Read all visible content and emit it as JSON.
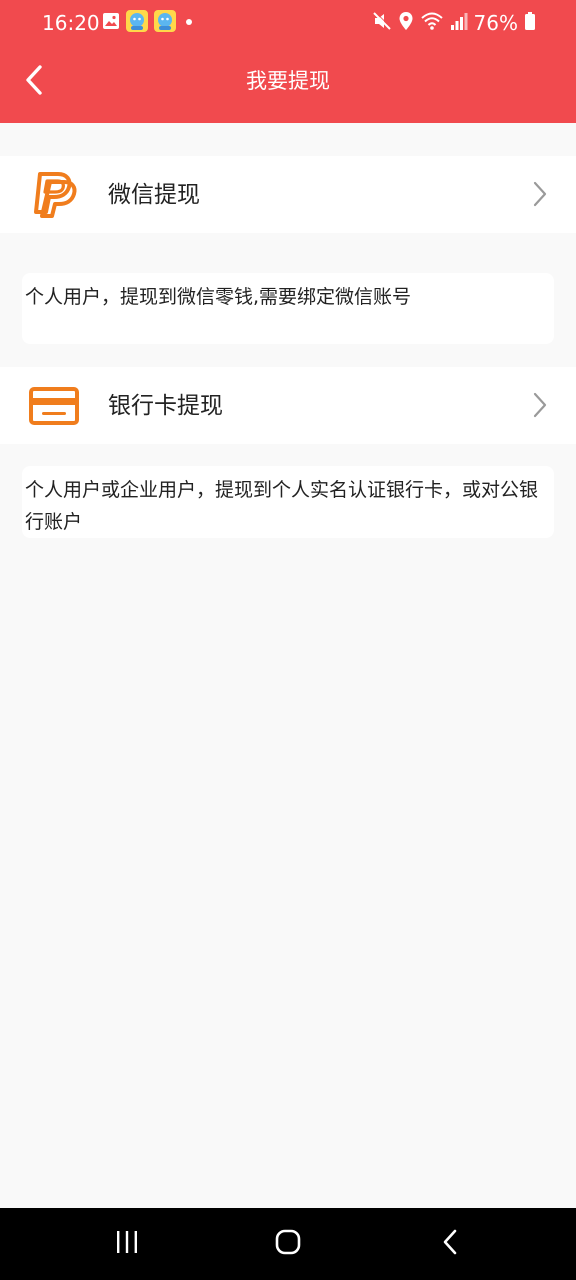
{
  "status_bar": {
    "time": "16:20",
    "battery": "76%"
  },
  "header": {
    "title": "我要提现"
  },
  "options": [
    {
      "label": "微信提现",
      "description": "个人用户，提现到微信零钱,需要绑定微信账号",
      "icon": "paypal-p-icon"
    },
    {
      "label": "银行卡提现",
      "description": "个人用户或企业用户，提现到个人实名认证银行卡，或对公银行账户",
      "icon": "credit-card-icon"
    }
  ],
  "colors": {
    "header_bg": "#f14a4e",
    "accent_orange": "#f07d1d",
    "page_bg": "#f9f9f9"
  },
  "icons": {
    "back": "chevron-left-icon",
    "row_arrow": "chevron-right-icon",
    "nav_recent": "recent-apps-icon",
    "nav_home": "home-icon",
    "nav_back": "back-icon"
  }
}
